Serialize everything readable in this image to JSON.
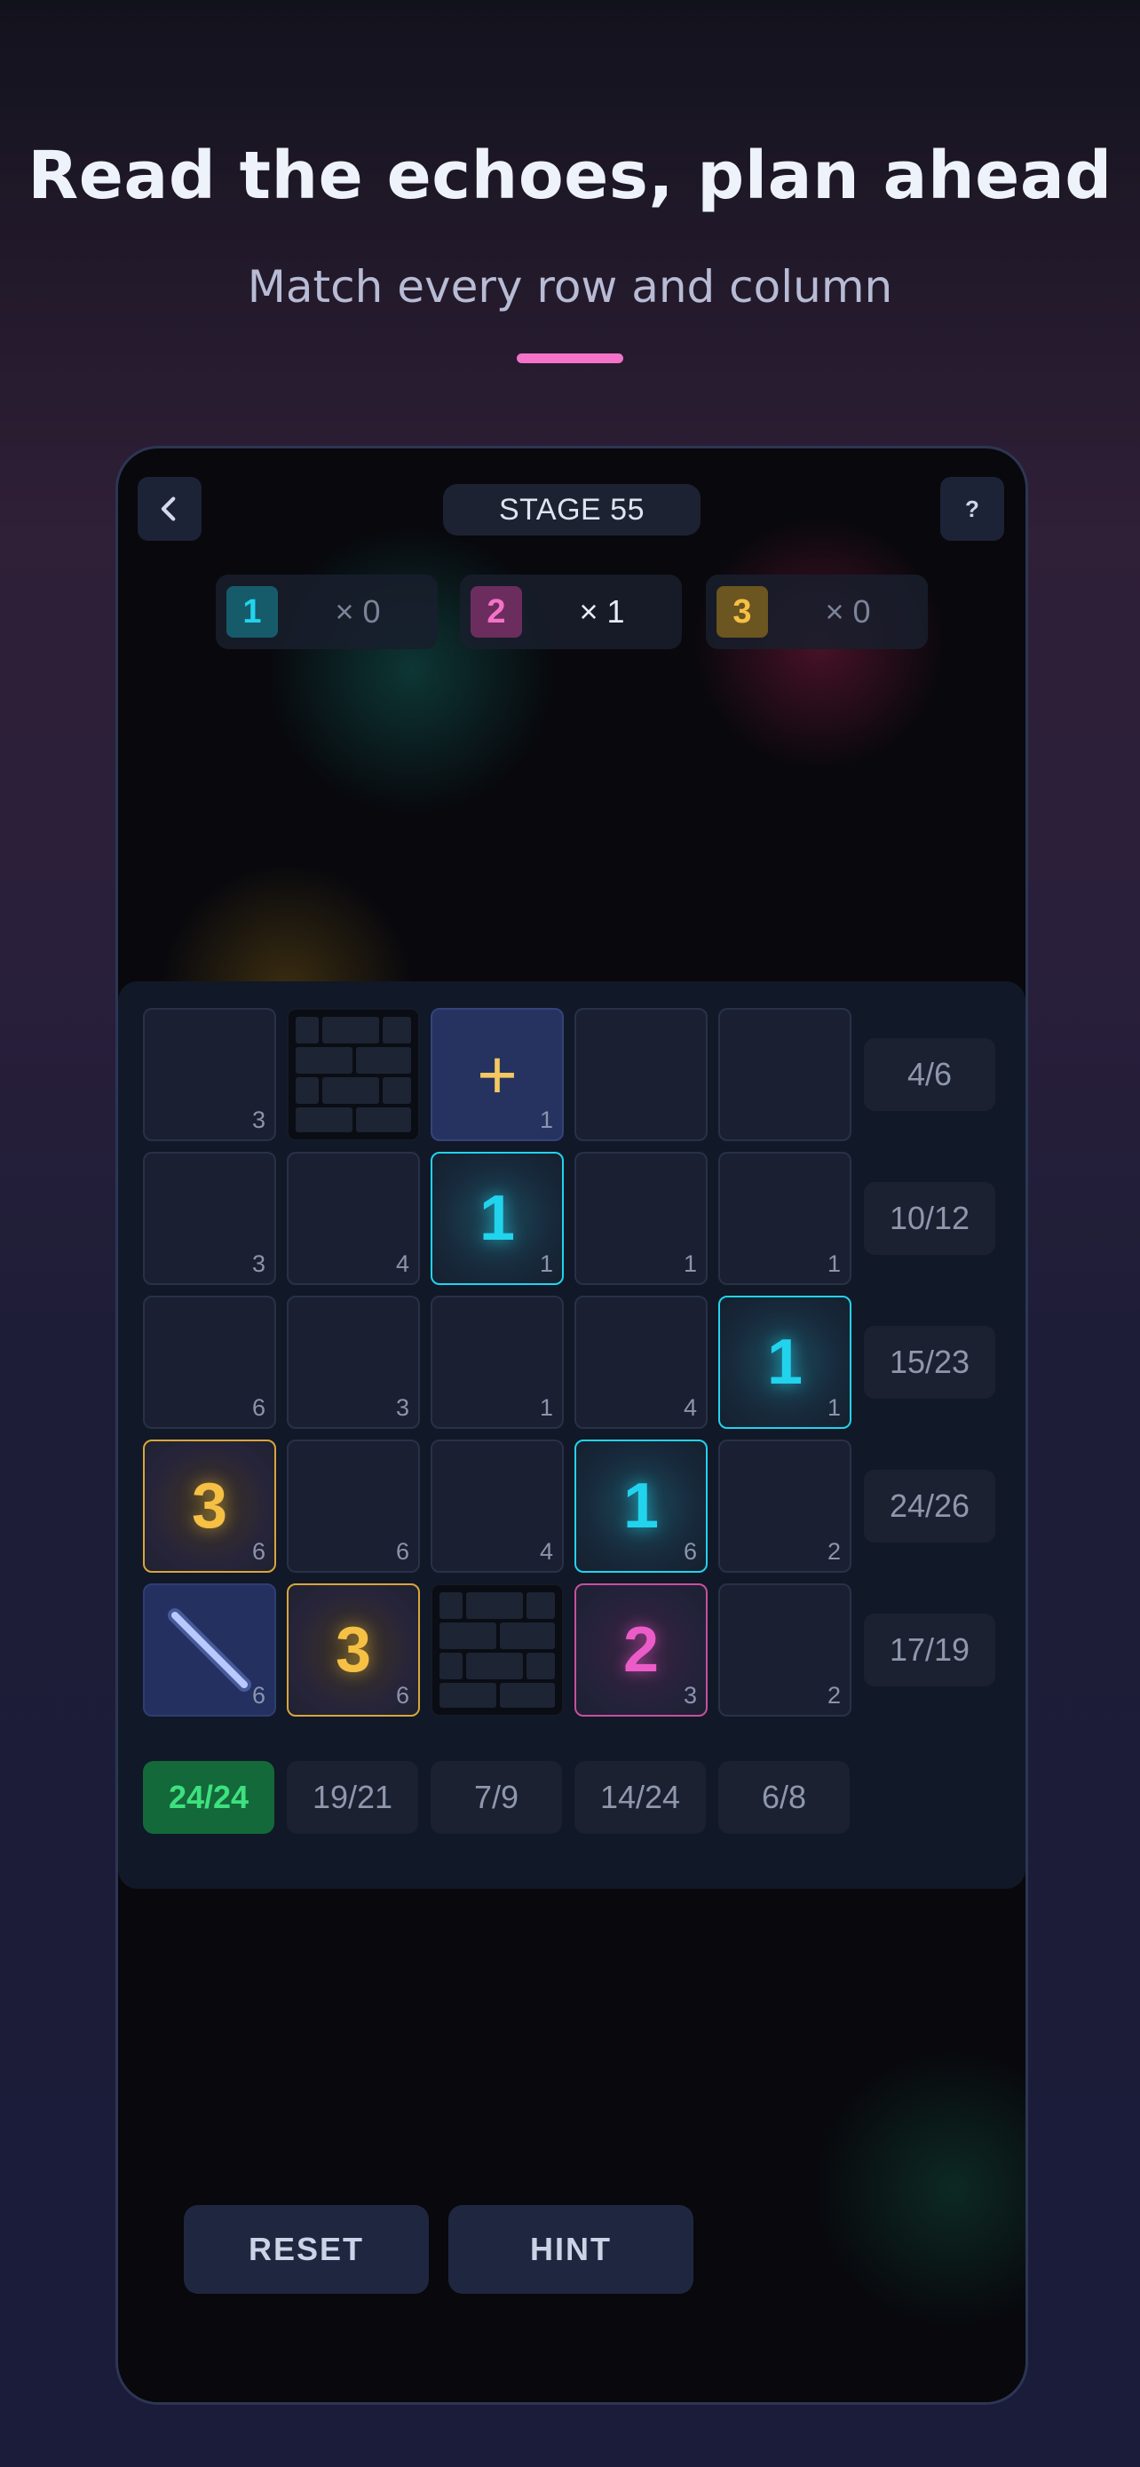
{
  "header": {
    "title": "Read the echoes, plan ahead",
    "subtitle": "Match every row and column"
  },
  "top_bar": {
    "back_icon": "chevron-left-icon",
    "stage_label": "STAGE 55",
    "help_label": "?"
  },
  "counters": [
    {
      "digit": "1",
      "count": "× 0",
      "color": "#22d3ee",
      "chip_bg": "#165b6a",
      "active": false
    },
    {
      "digit": "2",
      "count": "× 1",
      "color": "#f472c8",
      "chip_bg": "#6b2d5e",
      "active": true
    },
    {
      "digit": "3",
      "count": "× 0",
      "color": "#f5c043",
      "chip_bg": "#6b5520",
      "active": false
    }
  ],
  "grid": {
    "rows": [
      [
        {
          "type": "empty",
          "clue": "3"
        },
        {
          "type": "wall",
          "icon": "brick-wall-icon"
        },
        {
          "type": "plus",
          "symbol": "+",
          "clue": "1"
        },
        {
          "type": "empty",
          "clue": ""
        },
        {
          "type": "empty",
          "clue": ""
        }
      ],
      [
        {
          "type": "empty",
          "clue": "3"
        },
        {
          "type": "empty",
          "clue": "4"
        },
        {
          "type": "cyan",
          "value": "1",
          "clue": "1"
        },
        {
          "type": "empty",
          "clue": "1"
        },
        {
          "type": "empty",
          "clue": "1"
        }
      ],
      [
        {
          "type": "empty",
          "clue": "6"
        },
        {
          "type": "empty",
          "clue": "3"
        },
        {
          "type": "empty",
          "clue": "1"
        },
        {
          "type": "empty",
          "clue": "4"
        },
        {
          "type": "cyan",
          "value": "1",
          "clue": "1"
        }
      ],
      [
        {
          "type": "amber",
          "value": "3",
          "clue": "6"
        },
        {
          "type": "empty",
          "clue": "6"
        },
        {
          "type": "empty",
          "clue": "4"
        },
        {
          "type": "cyan",
          "value": "1",
          "clue": "6"
        },
        {
          "type": "empty",
          "clue": "2"
        }
      ],
      [
        {
          "type": "mirror",
          "icon": "mirror-diagonal-icon",
          "clue": "6"
        },
        {
          "type": "amber",
          "value": "3",
          "clue": "6"
        },
        {
          "type": "wall",
          "icon": "brick-wall-icon"
        },
        {
          "type": "pink",
          "value": "2",
          "clue": "3"
        },
        {
          "type": "empty",
          "clue": "2"
        }
      ]
    ],
    "row_targets": [
      "4/6",
      "10/12",
      "15/23",
      "24/26",
      "17/19"
    ],
    "column_targets": [
      {
        "text": "24/24",
        "complete": true
      },
      {
        "text": "19/21",
        "complete": false
      },
      {
        "text": "7/9",
        "complete": false
      },
      {
        "text": "14/24",
        "complete": false
      },
      {
        "text": "6/8",
        "complete": false
      }
    ]
  },
  "actions": {
    "reset_label": "RESET",
    "hint_label": "HINT"
  }
}
